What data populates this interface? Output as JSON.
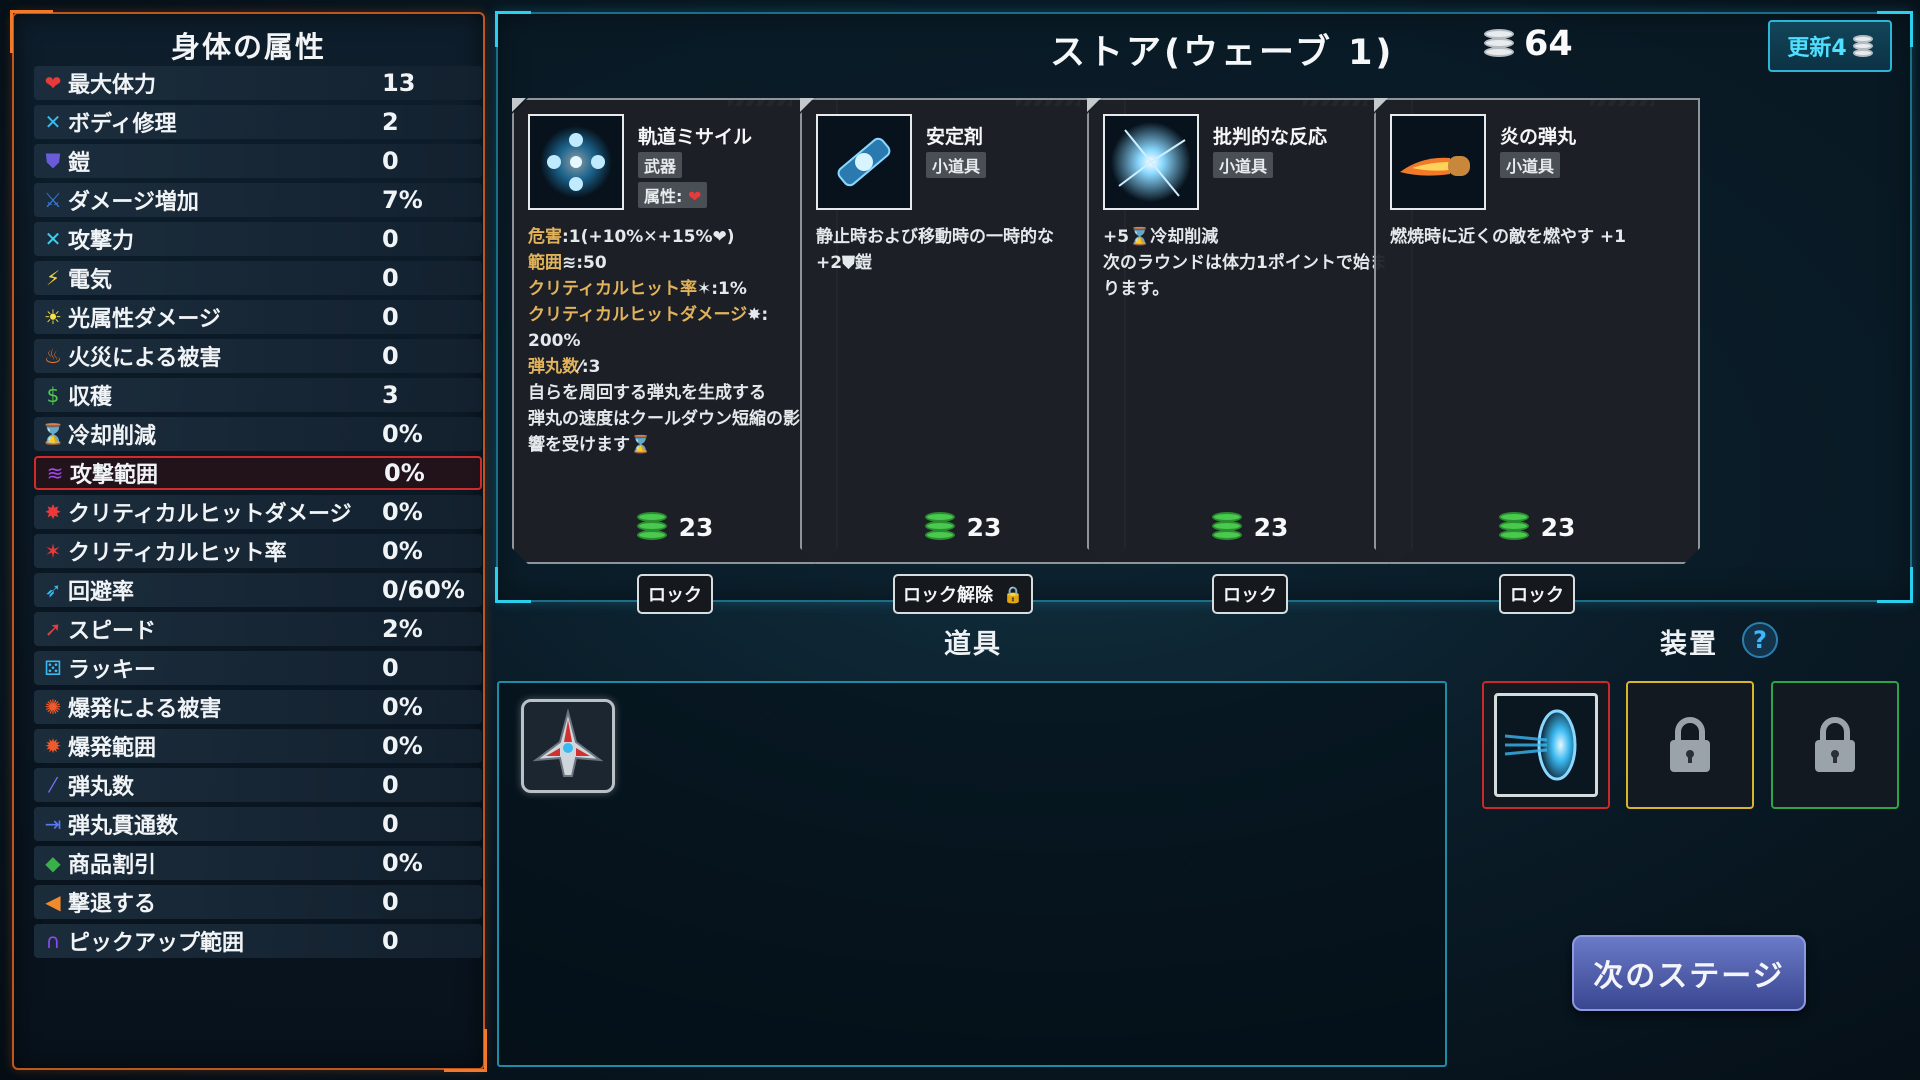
{
  "attributes": {
    "title": "身体の属性",
    "rows": [
      {
        "name": "最大体力",
        "value": "13",
        "icon": "heart-icon",
        "glyph": "❤",
        "color": "#e83a3a"
      },
      {
        "name": "ボディ修理",
        "value": "2",
        "icon": "repair-icon",
        "glyph": "✕",
        "color": "#3ab8f0"
      },
      {
        "name": "鎧",
        "value": "0",
        "icon": "armor-shield-icon",
        "glyph": "⛊",
        "color": "#6a5bd8"
      },
      {
        "name": "ダメージ増加",
        "value": "7%",
        "icon": "damage-up-icon",
        "glyph": "⚔",
        "color": "#3a7ad8"
      },
      {
        "name": "攻撃力",
        "value": "0",
        "icon": "attack-icon",
        "glyph": "✕",
        "color": "#3ad0f0"
      },
      {
        "name": "電気",
        "value": "0",
        "icon": "lightning-icon",
        "glyph": "⚡",
        "color": "#f0d23a"
      },
      {
        "name": "光属性ダメージ",
        "value": "0",
        "icon": "sun-icon",
        "glyph": "☀",
        "color": "#f5e04a"
      },
      {
        "name": "火災による被害",
        "value": "0",
        "icon": "fire-icon",
        "glyph": "♨",
        "color": "#f07a2a"
      },
      {
        "name": "収穫",
        "value": "3",
        "icon": "money-bag-icon",
        "glyph": "$",
        "color": "#4fc94e"
      },
      {
        "name": "冷却削減",
        "value": "0%",
        "icon": "hourglass-icon",
        "glyph": "⌛",
        "color": "#e84ad8"
      },
      {
        "name": "攻撃範囲",
        "value": "0%",
        "icon": "wifi-range-icon",
        "glyph": "≋",
        "color": "#a04af0"
      },
      {
        "name": "クリティカルヒットダメージ",
        "value": "0%",
        "icon": "crit-damage-icon",
        "glyph": "✸",
        "color": "#e83a3a"
      },
      {
        "name": "クリティカルヒット率",
        "value": "0%",
        "icon": "crit-rate-icon",
        "glyph": "✶",
        "color": "#e83a3a"
      },
      {
        "name": "回避率",
        "value": "0/60%",
        "icon": "dodge-icon",
        "glyph": "➶",
        "color": "#3ab8f0"
      },
      {
        "name": "スピード",
        "value": "2%",
        "icon": "rocket-icon",
        "glyph": "➚",
        "color": "#e83a3a"
      },
      {
        "name": "ラッキー",
        "value": "0",
        "icon": "dice-icon",
        "glyph": "⚄",
        "color": "#3ab8f0"
      },
      {
        "name": "爆発による被害",
        "value": "0%",
        "icon": "explosion-icon",
        "glyph": "✺",
        "color": "#f05a2a"
      },
      {
        "name": "爆発範囲",
        "value": "0%",
        "icon": "explosion-range-icon",
        "glyph": "✹",
        "color": "#f05a2a"
      },
      {
        "name": "弾丸数",
        "value": "0",
        "icon": "bullet-icon",
        "glyph": "⁄",
        "color": "#7a6af0"
      },
      {
        "name": "弾丸貫通数",
        "value": "0",
        "icon": "pierce-icon",
        "glyph": "⇥",
        "color": "#5a7af0"
      },
      {
        "name": "商品割引",
        "value": "0%",
        "icon": "tag-icon",
        "glyph": "◆",
        "color": "#3ab04a"
      },
      {
        "name": "撃退する",
        "value": "0",
        "icon": "knockback-icon",
        "glyph": "◀",
        "color": "#f08a2a"
      },
      {
        "name": "ピックアップ範囲",
        "value": "0",
        "icon": "magnet-icon",
        "glyph": "∩",
        "color": "#8a4af0"
      }
    ],
    "selected_index": 10
  },
  "store": {
    "title": "ストア(ウェーブ 1)",
    "coins": "64",
    "refresh_label": "更新4",
    "cards": [
      {
        "name": "軌道ミサイル",
        "type": "武器",
        "attr_label": "属性:",
        "attr_icon": "heart-icon",
        "desc": [
          {
            "hl": "危害",
            "text": ":1(+10%✕+15%❤)"
          },
          {
            "hl": "範囲",
            "text": "≋:50"
          },
          {
            "hl": "クリティカルヒット率",
            "text": "✶:1%"
          },
          {
            "hl": "クリティカルヒットダメージ",
            "text": "✸:"
          },
          {
            "hl": "",
            "text": "200%"
          },
          {
            "hl": "弾丸数",
            "text": "⁄:3"
          },
          {
            "hl": "",
            "text": "自らを周回する弾丸を生成する"
          },
          {
            "hl": "",
            "text": "弾丸の速度はクールダウン短縮の影"
          },
          {
            "hl": "",
            "text": "響を受けます⌛"
          }
        ],
        "price": "23",
        "lock_label": "ロック",
        "locked": false
      },
      {
        "name": "安定剤",
        "type": "小道具",
        "desc": [
          {
            "hl": "",
            "text": "静止時および移動時の一時的な"
          },
          {
            "hl": "",
            "text": "+2⛊鎧"
          }
        ],
        "price": "23",
        "lock_label": "ロック解除",
        "locked": true
      },
      {
        "name": "批判的な反応",
        "type": "小道具",
        "desc": [
          {
            "hl": "",
            "text": "+5⌛冷却削減"
          },
          {
            "hl": "",
            "text": "次のラウンドは体力1ポイントで始ま"
          },
          {
            "hl": "",
            "text": "ります。"
          }
        ],
        "price": "23",
        "lock_label": "ロック",
        "locked": false
      },
      {
        "name": "炎の弾丸",
        "type": "小道具",
        "desc": [
          {
            "hl": "",
            "text": "燃焼時に近くの敵を燃やす +1"
          }
        ],
        "price": "23",
        "lock_label": "ロック",
        "locked": false
      }
    ]
  },
  "inventory": {
    "title": "道具",
    "items": [
      {
        "icon": "spaceship-icon"
      }
    ]
  },
  "equipment": {
    "title": "装置",
    "help": "?",
    "slots": [
      {
        "state": "filled",
        "icon": "portal-icon"
      },
      {
        "state": "locked",
        "icon": "padlock-icon"
      },
      {
        "state": "locked",
        "icon": "padlock-icon"
      }
    ]
  },
  "next_stage_label": "次のステージ"
}
